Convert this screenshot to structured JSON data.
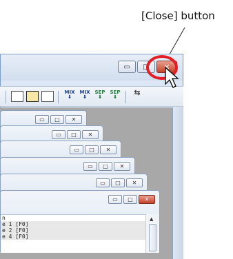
{
  "callout": {
    "text": "[Close] button"
  },
  "main_window": {
    "minimize_glyph": "▭",
    "maximize_glyph": "□",
    "close_glyph": "✕"
  },
  "toolbar": {
    "mix1": "MIX",
    "mix2": "MIX",
    "sep1": "SEP",
    "sep2": "SEP"
  },
  "child_windows": {
    "minimize_glyph": "▭",
    "maximize_glyph": "□",
    "close_glyph": "✕"
  },
  "list": {
    "header": "n",
    "rows": [
      "e 1 [F0]",
      "e 2 [F0]",
      "e 4 [F0]"
    ]
  },
  "colors": {
    "highlight": "#e41e26",
    "close_button": "#c8412a",
    "mdi_background": "#a8a8a8"
  }
}
